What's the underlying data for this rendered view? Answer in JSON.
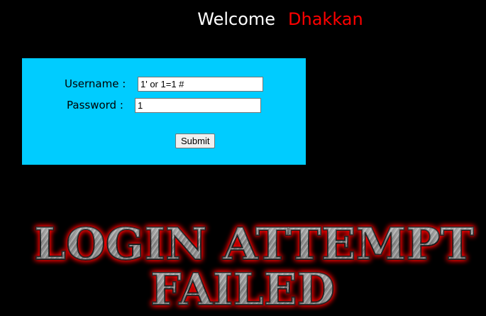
{
  "header": {
    "welcome": "Welcome",
    "name": "Dhakkan"
  },
  "login": {
    "username_label": "Username :",
    "password_label": "Password :",
    "username_value": "1' or 1=1 #",
    "password_value": "1",
    "submit_label": "Submit"
  },
  "banner": {
    "line1": "LOGIN ATTEMPT",
    "line2": "FAILED"
  },
  "colors": {
    "background": "#000000",
    "form_bg": "#00ccff",
    "name": "#ff0000",
    "banner_glow": "#ff0000"
  }
}
